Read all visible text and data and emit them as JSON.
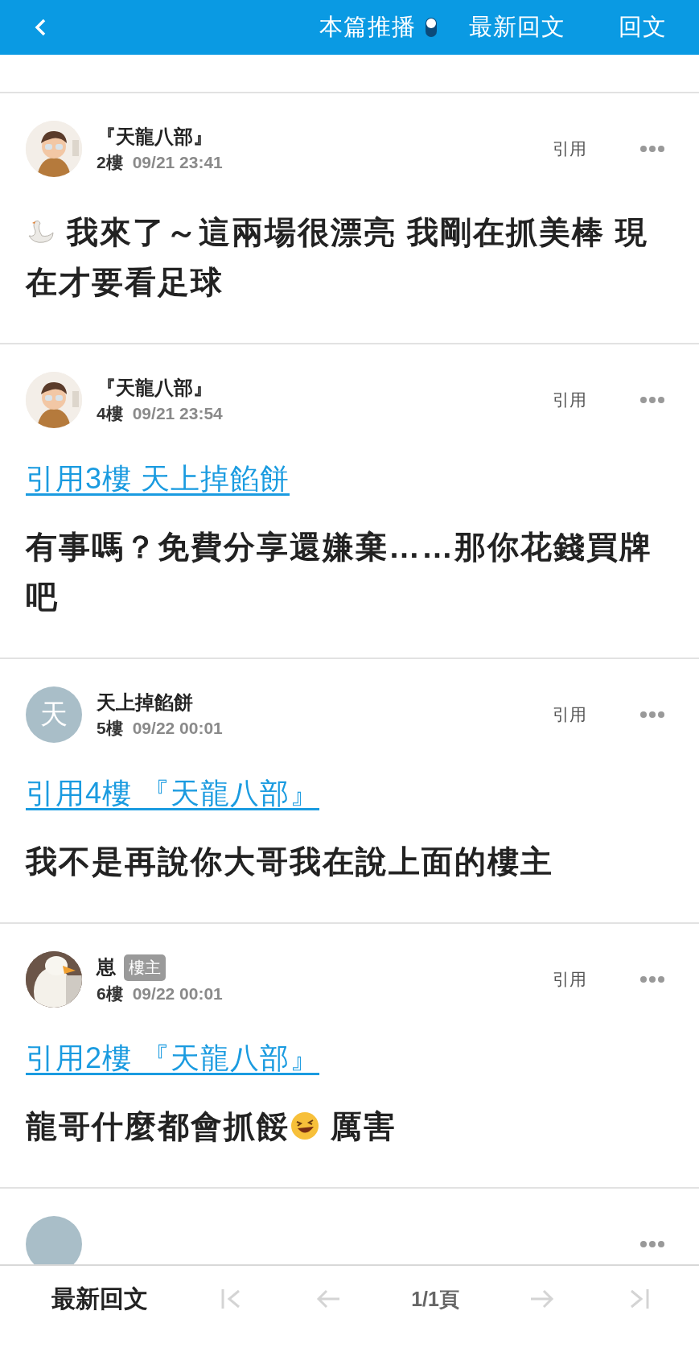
{
  "top_bar": {
    "push": {
      "label": "本篇推播",
      "on": false
    },
    "links": [
      "最新回文",
      "回文"
    ]
  },
  "posts": [
    {
      "avatar": {
        "kind": "picture"
      },
      "author": "『天龍八部』",
      "floor": "2樓",
      "time": "09/21 23:41",
      "quote_button": "引用",
      "body": [
        {
          "kind": "swan"
        },
        {
          "kind": "text",
          "text": " 我來了～這兩場很漂亮 我剛在抓美棒 現"
        },
        {
          "kind": "line",
          "text": "在才要看足球"
        }
      ]
    },
    {
      "avatar": {
        "kind": "picture"
      },
      "author": "『天龍八部』",
      "floor": "4樓",
      "time": "09/21 23:54",
      "quote_button": "引用",
      "quote_link": "引用3樓 天上掉餡餅",
      "body": [
        {
          "kind": "text",
          "text": "有事嗎？免費分享還嫌棄……那你花錢買牌吧"
        }
      ]
    },
    {
      "avatar": {
        "kind": "letter",
        "letter": "天"
      },
      "author": "天上掉餡餅",
      "floor": "5樓",
      "time": "09/22 00:01",
      "quote_button": "引用",
      "quote_link": "引用4樓 『天龍八部』",
      "body": [
        {
          "kind": "text",
          "text": "我不是再說你大哥我在說上面的樓主"
        }
      ]
    },
    {
      "avatar": {
        "kind": "picture"
      },
      "author": "崽",
      "badge": "樓主",
      "floor": "6樓",
      "time": "09/22 00:01",
      "quote_button": "引用",
      "quote_link": "引用2樓 『天龍八部』",
      "body": [
        {
          "kind": "text",
          "text": "龍哥什麼都會抓餒"
        },
        {
          "kind": "laugh"
        },
        {
          "kind": "text",
          "text": " 厲害"
        }
      ]
    },
    {
      "avatar": {
        "kind": "letter"
      }
    }
  ],
  "bottom_bar": {
    "latest": "最新回文",
    "page": "1/1頁",
    "nav": [
      {
        "kind": "first",
        "disabled": true
      },
      {
        "kind": "prev",
        "disabled": true
      },
      {
        "kind": "next",
        "disabled": true
      },
      {
        "kind": "last",
        "disabled": true
      }
    ]
  }
}
